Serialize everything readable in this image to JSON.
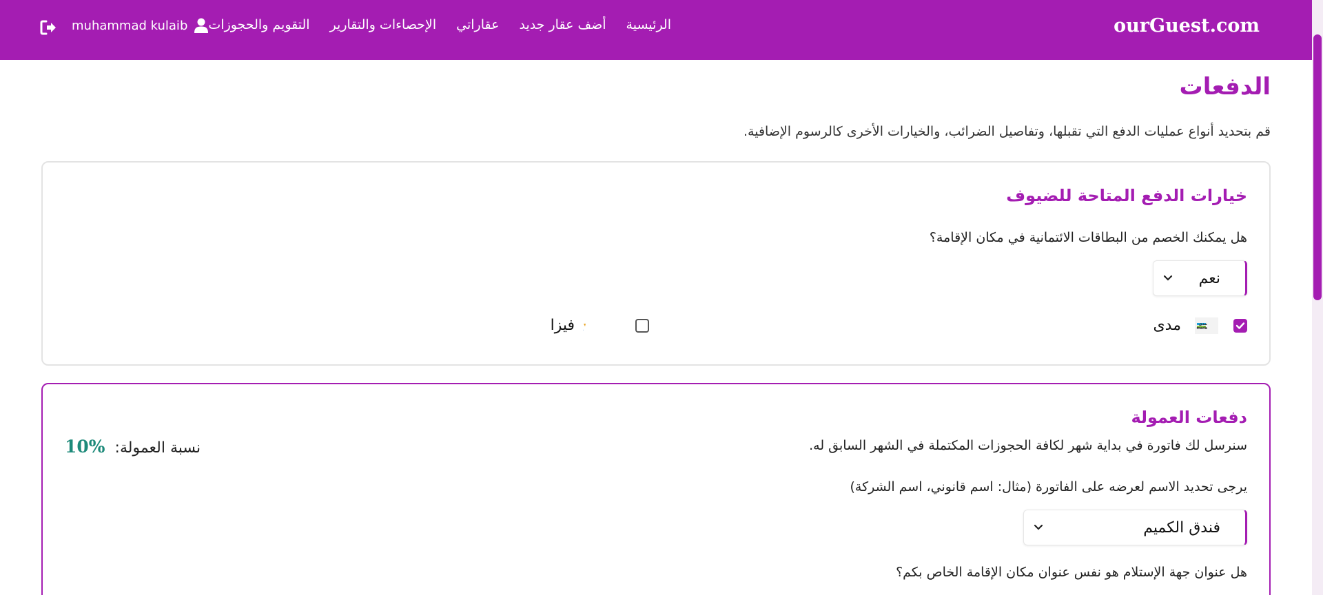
{
  "navbar": {
    "brand": "ourGuest.com",
    "links": [
      "الرئيسية",
      "أضف عقار جديد",
      "عقاراتي",
      "الإحصاءات والتقارير",
      "التقويم والحجوزات"
    ],
    "user_name": "muhammad kulaib",
    "bg_color": "#a41db2"
  },
  "page": {
    "title": "الدفعات",
    "description": "قم بتحديد أنواع عمليات الدفع التي تقبلها، وتفاصيل الضرائب، والخيارات الأخرى كالرسوم الإضافية."
  },
  "payment_options": {
    "title": "خيارات الدفع المتاحة للضيوف",
    "question": "هل يمكنك الخصم من البطاقات الائتمانية في مكان الإقامة؟",
    "answer": "نعم",
    "methods": [
      {
        "label": "مدى",
        "checked": true,
        "icon": "mada-logo"
      },
      {
        "label": "فيزا",
        "checked": false,
        "icon": "visa-logo"
      }
    ]
  },
  "commission": {
    "title": "دفعات العمولة",
    "invoice_note": "سنرسل لك فاتورة في بداية شهر لكافة الحجوزات المكتملة في الشهر السابق له.",
    "rate_label": "نسبة العمولة:",
    "rate_value": "10%",
    "invoice_name_question": "يرجى تحديد الاسم لعرضه على الفاتورة (مثال: اسم قانوني، اسم الشركة)",
    "invoice_name_value": "فندق الكميم",
    "address_question": "هل عنوان جهة الإستلام هو نفس عنوان مكان الإقامة الخاص بكم؟"
  }
}
